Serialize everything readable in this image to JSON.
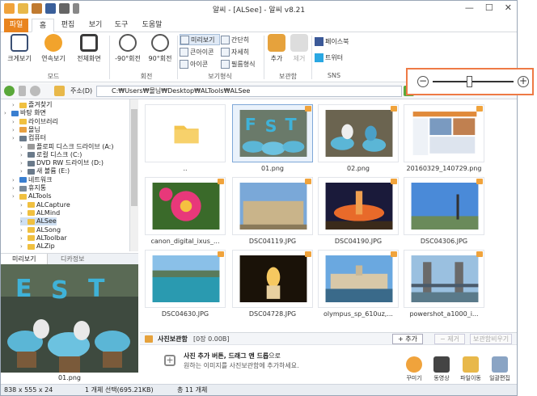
{
  "window": {
    "title": "알씨 - [ALSee] - 알씨 v8.21",
    "min": "—",
    "max": "☐",
    "close": "✕"
  },
  "tabs": [
    "파일",
    "홈",
    "편집",
    "보기",
    "도구",
    "도움말"
  ],
  "ribbon": {
    "view_buttons": [
      "크게보기",
      "연속보기",
      "전체화면"
    ],
    "rotate_buttons": [
      "-90°회전",
      "90°회전"
    ],
    "group_labels": [
      "모드",
      "회전",
      "보기형식",
      "보관함",
      "SNS"
    ],
    "view_modes_col1": [
      "미리보기",
      "큰아이콘",
      "아이콘"
    ],
    "view_modes_col2": [
      "간단히",
      "자세히",
      "필름형식"
    ],
    "storage_buttons": [
      "추가",
      "제거"
    ],
    "sns_items": [
      "페이스북",
      "트위터"
    ]
  },
  "address": {
    "label": "주소(D)",
    "path": "C:₩Users₩몰님₩Desktop₩ALTools₩ALSee"
  },
  "tree": [
    {
      "label": "즐겨찾기",
      "indent": 1
    },
    {
      "label": "바탕 화면",
      "indent": 0
    },
    {
      "label": "라이브러리",
      "indent": 1
    },
    {
      "label": "몰님",
      "indent": 1
    },
    {
      "label": "컴퓨터",
      "indent": 1
    },
    {
      "label": "플로피 디스크 드라이브 (A:)",
      "indent": 2
    },
    {
      "label": "로컬 디스크 (C:)",
      "indent": 2
    },
    {
      "label": "DVD RW 드라이브 (D:)",
      "indent": 2
    },
    {
      "label": "새 볼륨 (E:)",
      "indent": 2
    },
    {
      "label": "네트워크",
      "indent": 1
    },
    {
      "label": "휴지통",
      "indent": 1
    },
    {
      "label": "ALTools",
      "indent": 1
    },
    {
      "label": "ALCapture",
      "indent": 2
    },
    {
      "label": "ALMind",
      "indent": 2
    },
    {
      "label": "ALSee",
      "indent": 2
    },
    {
      "label": "ALSong",
      "indent": 2
    },
    {
      "label": "ALToolbar",
      "indent": 2
    },
    {
      "label": "ALZip",
      "indent": 2
    }
  ],
  "preview_tabs": [
    "미리보기",
    "디카정보"
  ],
  "preview_filename": "01.png",
  "thumbnails": [
    {
      "name": "..",
      "kind": "folder"
    },
    {
      "name": "01.png",
      "kind": "cupcake",
      "selected": true
    },
    {
      "name": "02.png",
      "kind": "cupcake2"
    },
    {
      "name": "20160329_140729.png",
      "kind": "screenshot"
    },
    {
      "name": "canon_digital_ixus_...",
      "kind": "flower"
    },
    {
      "name": "DSC04119.JPG",
      "kind": "building"
    },
    {
      "name": "DSC04190.JPG",
      "kind": "fountain"
    },
    {
      "name": "DSC04306.JPG",
      "kind": "sky"
    },
    {
      "name": "DSC04630.JPG",
      "kind": "coast"
    },
    {
      "name": "DSC04728.JPG",
      "kind": "candle"
    },
    {
      "name": "olympus_sp_610uz,...",
      "kind": "parliament"
    },
    {
      "name": "powershot_a1000_i...",
      "kind": "bridge"
    }
  ],
  "photobox": {
    "title": "사진보관함",
    "info": "[0장 0.00B]",
    "add": "+ 추가",
    "remove": "− 제거",
    "clear": "보관함비우기",
    "hint_bold": "사진 추가 버튼, 드래그 앤 드롭",
    "hint_tail": "으로",
    "hint_line2": "원하는 이미지를 사진보관함에 추가하세요.",
    "actions": [
      "꾸미기",
      "동영상",
      "파일이동",
      "일괄편집"
    ]
  },
  "status": {
    "dims": "838 x 555 x 24",
    "selection": "1 개체 선택(695.21KB)",
    "total": "총 11 개체"
  },
  "zoom": {
    "minus": "−",
    "plus": "+",
    "level": 0.45
  },
  "colors": {
    "accent_orange": "#e9841e",
    "zoom_highlight": "#ee7a45",
    "selection_blue": "#cfe0f3",
    "nav_green": "#5aa83a"
  }
}
